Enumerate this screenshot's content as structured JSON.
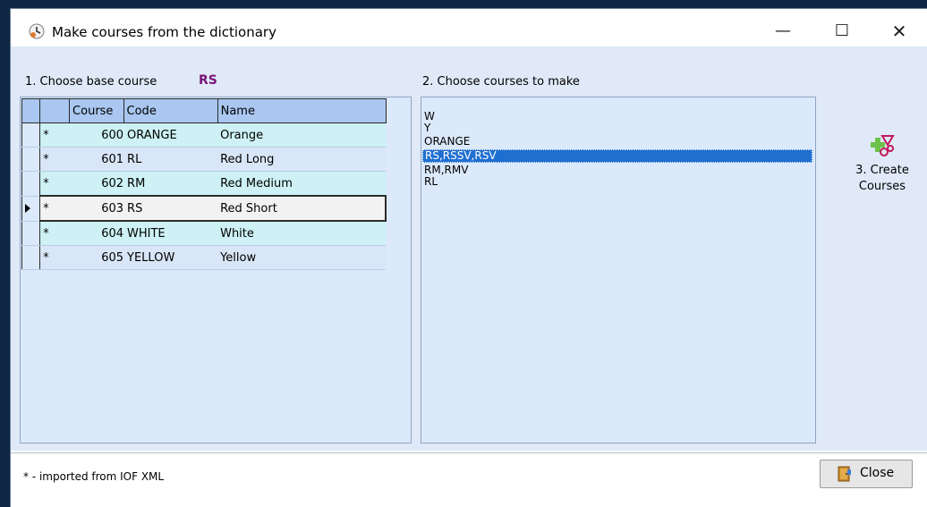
{
  "window": {
    "title": "Make courses from the dictionary"
  },
  "steps": {
    "choose_base": "1. Choose base course",
    "base_code": "RS",
    "choose_make": "2. Choose courses to make",
    "create_line1": "3. Create",
    "create_line2": "Courses"
  },
  "grid": {
    "headers": [
      "Course",
      "Code",
      "Name"
    ],
    "rows": [
      {
        "star": "*",
        "course": "600",
        "code": "ORANGE",
        "name": "Orange"
      },
      {
        "star": "*",
        "course": "601",
        "code": "RL",
        "name": "Red Long"
      },
      {
        "star": "*",
        "course": "602",
        "code": "RM",
        "name": "Red Medium"
      },
      {
        "star": "*",
        "course": "603",
        "code": "RS",
        "name": "Red Short"
      },
      {
        "star": "*",
        "course": "604",
        "code": "WHITE",
        "name": "White"
      },
      {
        "star": "*",
        "course": "605",
        "code": "YELLOW",
        "name": "Yellow"
      }
    ],
    "selected_index": 3
  },
  "courses_list": {
    "items": [
      "W",
      "Y",
      "ORANGE",
      "RS,RSSV,RSV",
      "RM,RMV",
      "RL"
    ],
    "selected_index": 3
  },
  "status": {
    "note": "* - imported from IOF XML"
  },
  "buttons": {
    "close": "Close"
  },
  "colors": {
    "accent": "#7a137a",
    "selection": "#1f6fd1",
    "grid_row_odd": "#cdf1f4",
    "grid_row_even": "#d9e6f7",
    "grid_header": "#a9c7f0"
  },
  "icons": {
    "app": "clock-icon",
    "create": "create-courses-icon",
    "close": "door-icon"
  }
}
